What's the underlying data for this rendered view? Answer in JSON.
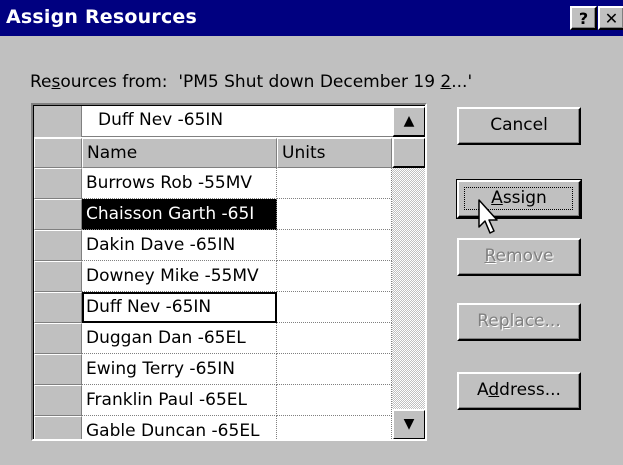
{
  "window": {
    "title": "Assign Resources",
    "help_glyph": "?",
    "close_glyph": "✕"
  },
  "resources_from": {
    "prefix": "Re",
    "mnemonic": "s",
    "rest": "ources from:  'PM5 Shut down December 19 ",
    "tail_mnemonic": "2",
    "tail": "...'"
  },
  "editor": {
    "value": "Duff Nev -65IN"
  },
  "table": {
    "headers": [
      "Name",
      "Units"
    ],
    "rows": [
      {
        "name": "Burrows Rob -55MV",
        "units": ""
      },
      {
        "name": "Chaisson Garth -65I",
        "units": ""
      },
      {
        "name": "Dakin Dave -65IN",
        "units": ""
      },
      {
        "name": "Downey Mike -55MV",
        "units": ""
      },
      {
        "name": "Duff Nev -65IN",
        "units": ""
      },
      {
        "name": "Duggan Dan -65EL",
        "units": ""
      },
      {
        "name": "Ewing Terry -65IN",
        "units": ""
      },
      {
        "name": "Franklin Paul -65EL",
        "units": ""
      },
      {
        "name": "Gable Duncan -65EL",
        "units": ""
      }
    ],
    "selected_row": 1,
    "focused_row": 4
  },
  "scroll": {
    "up_glyph": "▲",
    "down_glyph": "▼"
  },
  "buttons": {
    "cancel": {
      "label": "Cancel"
    },
    "assign": {
      "mnemonic": "A",
      "rest": "ssign"
    },
    "remove": {
      "mnemonic": "R",
      "rest": "emove"
    },
    "replace": {
      "pre": "Re",
      "mnemonic": "p",
      "rest": "lace..."
    },
    "address": {
      "pre": "A",
      "mnemonic": "d",
      "rest": "dress..."
    }
  },
  "colors": {
    "titlebar": "#000080",
    "face": "#c0c0c0",
    "selection": "#000000",
    "disabled_text": "#808080"
  }
}
